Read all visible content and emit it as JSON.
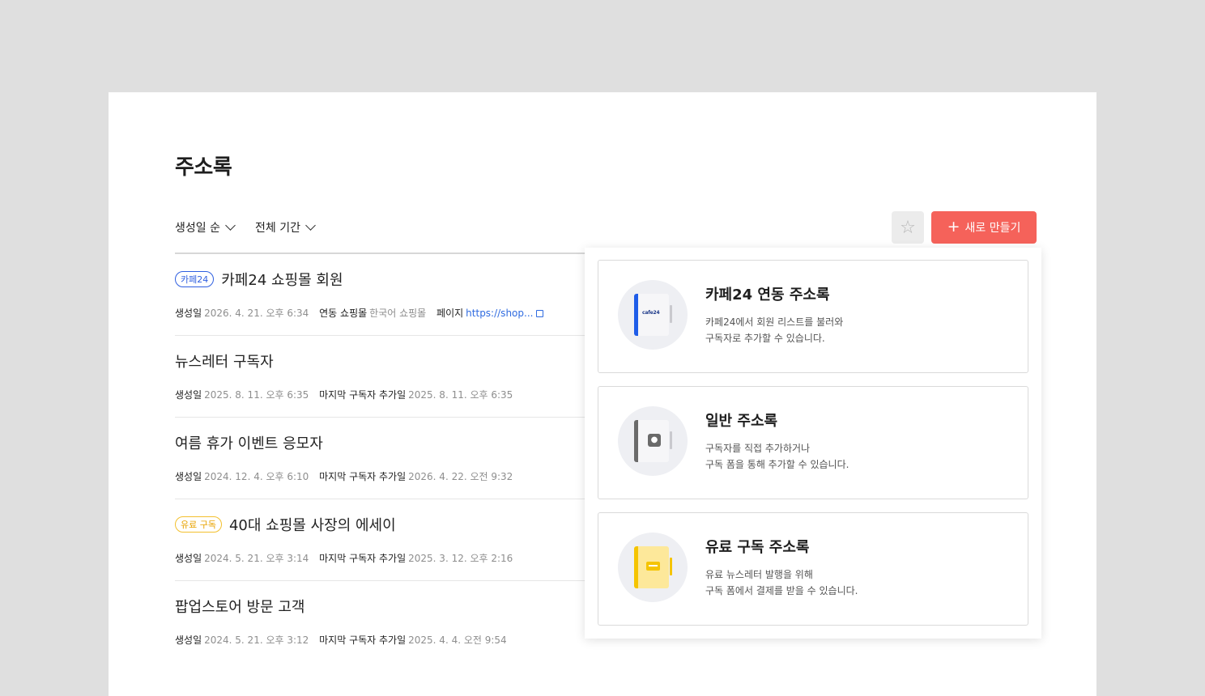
{
  "page": {
    "title": "주소록"
  },
  "toolbar": {
    "sort_label": "생성일 순",
    "period_label": "전체 기간",
    "star_icon": "star-icon",
    "new_label": "새로 만들기",
    "new_plus": "+"
  },
  "list": [
    {
      "badge": "카페24",
      "title": "카페24 쇼핑몰 회원",
      "meta": [
        {
          "k": "생성일",
          "v": "2026. 4. 21. 오후 6:34"
        },
        {
          "k": "연동 쇼핑몰",
          "v": "한국어 쇼핑몰"
        },
        {
          "k": "페이지",
          "link": "https://shop..."
        }
      ]
    },
    {
      "title": "뉴스레터 구독자",
      "meta": [
        {
          "k": "생성일",
          "v": "2025. 8. 11. 오후 6:35"
        },
        {
          "k": "마지막 구독자 추가일",
          "v": "2025. 8. 11. 오후 6:35"
        }
      ]
    },
    {
      "title": "여름 휴가 이벤트 응모자",
      "meta": [
        {
          "k": "생성일",
          "v": "2024. 12. 4. 오후 6:10"
        },
        {
          "k": "마지막 구독자 추가일",
          "v": "2026. 4. 22. 오전 9:32"
        }
      ]
    },
    {
      "badge": "유료 구독",
      "title": "40대 쇼핑몰 사장의 에세이",
      "meta": [
        {
          "k": "생성일",
          "v": "2024. 5. 21. 오후 3:14"
        },
        {
          "k": "마지막 구독자 추가일",
          "v": "2025. 3. 12. 오후 2:16"
        }
      ]
    },
    {
      "title": "팝업스토어 방문 고객",
      "meta": [
        {
          "k": "생성일",
          "v": "2024. 5. 21. 오후 3:12"
        },
        {
          "k": "마지막 구독자 추가일",
          "v": "2025. 4. 4. 오전 9:54"
        }
      ]
    }
  ],
  "popup": {
    "cards": [
      {
        "title": "카페24 연동 주소록",
        "desc1": "카페24에서 회원 리스트를 불러와",
        "desc2": "구독자로 추가할 수 있습니다.",
        "logo": "cafe24"
      },
      {
        "title": "일반 주소록",
        "desc1": "구독자를 직접 추가하거나",
        "desc2": "구독 폼을 통해 추가할 수 있습니다."
      },
      {
        "title": "유료 구독 주소록",
        "desc1": "유료 뉴스레터 발행을 위해",
        "desc2": "구독 폼에서 결제를 받을 수 있습니다."
      }
    ]
  },
  "colors": {
    "accent": "#f5625a",
    "link": "#2f6be0",
    "badge_blue": "#2f5fe0",
    "badge_yellow": "#f3c02e"
  }
}
